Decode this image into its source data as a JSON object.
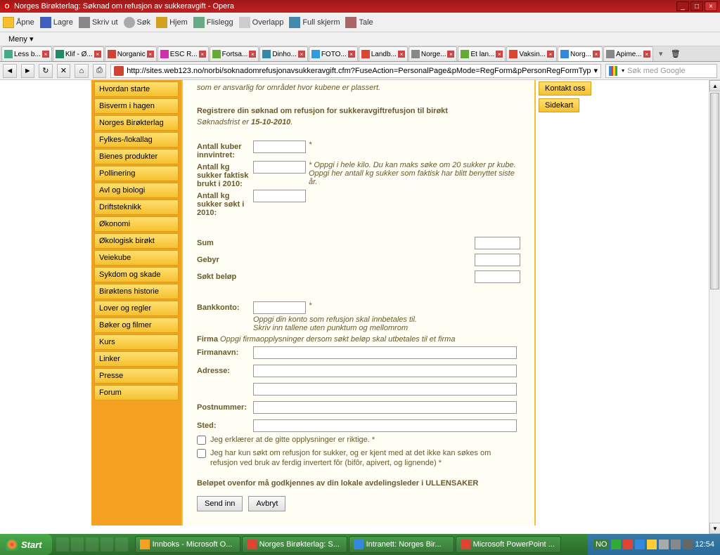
{
  "window": {
    "title": "Norges Birøkterlag: Søknad om refusjon av sukkeravgift - Opera"
  },
  "toolbar": {
    "open": "Åpne",
    "save": "Lagre",
    "print": "Skriv ut",
    "search": "Søk",
    "home": "Hjem",
    "flislegg": "Flislegg",
    "overlap": "Overlapp",
    "fullscreen": "Full skjerm",
    "talk": "Tale",
    "meny": "Meny"
  },
  "tabs": [
    {
      "label": "Less b...",
      "icon": "#4a8"
    },
    {
      "label": "Klif - Ø...",
      "icon": "#286"
    },
    {
      "label": "Norganic",
      "icon": "#c43"
    },
    {
      "label": "ESC R...",
      "icon": "#c3a"
    },
    {
      "label": "Fortsa...",
      "icon": "#6a3"
    },
    {
      "label": "Dinho...",
      "icon": "#38a"
    },
    {
      "label": "FOTO...",
      "icon": "#39d"
    },
    {
      "label": "Landb...",
      "icon": "#d43"
    },
    {
      "label": "Norge...",
      "icon": "#888"
    },
    {
      "label": "Et lan...",
      "icon": "#6a3"
    },
    {
      "label": "Vaksin...",
      "icon": "#d43"
    },
    {
      "label": "Norg...",
      "icon": "#38d",
      "active": true
    },
    {
      "label": "Apime...",
      "icon": "#888"
    }
  ],
  "address": {
    "url": "http://sites.web123.no/norbi/soknadomrefusjonavsukkeravgift.cfm?FuseAction=PersonalPage&pMode=RegForm&pPersonRegFormTyp",
    "search_placeholder": "Søk med Google"
  },
  "sidebar": {
    "items": [
      "Hvordan starte",
      "Bisverm i hagen",
      "Norges Birøkterlag",
      "Fylkes-/lokallag",
      "Bienes produkter",
      "Pollinering",
      "Avl og biologi",
      "Driftsteknikk",
      "Økonomi",
      "Økologisk birøkt",
      "Veiekube",
      "Sykdom og skade",
      "Birøktens historie",
      "Lover og regler",
      "Bøker og filmer",
      "Kurs",
      "Linker",
      "Presse",
      "Forum"
    ]
  },
  "rightbar": {
    "kontakt": "Kontakt oss",
    "sidekart": "Sidekart"
  },
  "form": {
    "intro": "som er ansvarlig for området hvor kubene er plassert.",
    "header": "Registrere din søknad om refusjon for sukkeravgiftrefusjon til birøkt",
    "deadline_pre": "Søknadsfrist er ",
    "deadline": "15-10-2010",
    "kuber_label": "Antall kuber innvintret:",
    "kg_label": "Antall kg sukker faktisk brukt i 2010:",
    "kg_help": "* Oppgi i hele kilo. Du kan maks søke om 20 sukker pr kube. Oppgi her antall kg sukker som faktisk har blitt benyttet siste år.",
    "kg_sokt_label": "Antall kg sukker søkt i 2010:",
    "sum": "Sum",
    "gebyr": "Gebyr",
    "sokt_belop": "Søkt beløp",
    "bank_label": "Bankkonto:",
    "bank_help1": "Oppgi din konto som refusjon skal innbetales til.",
    "bank_help2": "Skriv inn tallene uten punktum og mellomrom",
    "firma_label": "Firma",
    "firma_help": "Oppgi firmaopplysninger dersom søkt beløp skal utbetales til et firma",
    "firmanavn": "Firmanavn:",
    "adresse": "Adresse:",
    "postnummer": "Postnummer:",
    "sted": "Sted:",
    "chk1": "Jeg erklærer at de gitte opplysninger er riktige. *",
    "chk2": "Jeg har kun søkt om refusjon for sukker, og er kjent med at det ikke kan søkes om refusjon ved bruk av ferdig invertert fôr (bifôr, apivert, og lignende) *",
    "approve": "Beløpet ovenfor må godkjennes av din lokale avdelingsleder i ULLENSAKER",
    "submit": "Send inn",
    "cancel": "Avbryt"
  },
  "taskbar": {
    "start": "Start",
    "tasks": [
      {
        "label": "Innboks - Microsoft O...",
        "icon": "#f4a020"
      },
      {
        "label": "Norges Birøkterlag: S...",
        "icon": "#d43"
      },
      {
        "label": "Intranett: Norges Bir...",
        "icon": "#38d"
      },
      {
        "label": "Microsoft PowerPoint ...",
        "icon": "#d43"
      }
    ],
    "clock": "12:54",
    "tray_no": "NO"
  }
}
